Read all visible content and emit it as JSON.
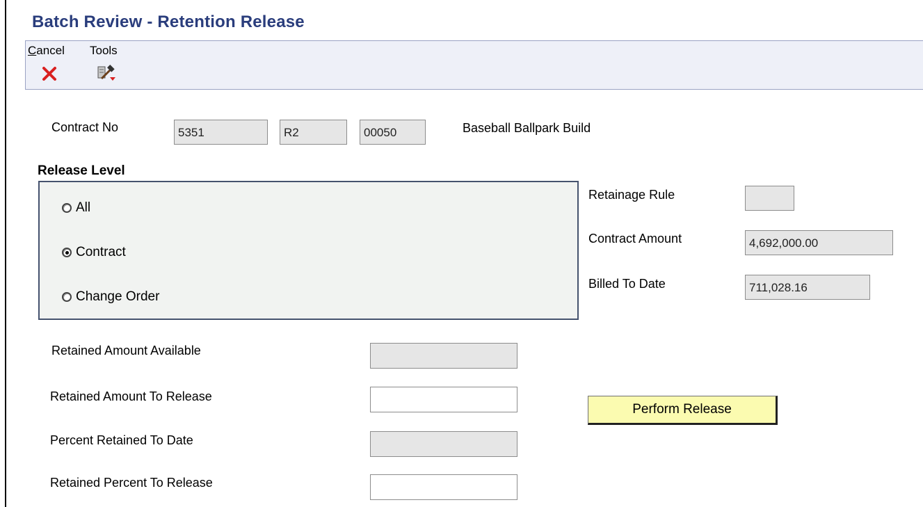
{
  "title": "Batch Review - Retention Release",
  "toolbar": {
    "cancel_label_first": "C",
    "cancel_label_rest": "ancel",
    "cancel_icon": "red-x-icon",
    "tools_label": "Tools",
    "tools_icon": "tools-hammer-icon"
  },
  "contract": {
    "label": "Contract No",
    "number": "5351",
    "type": "R2",
    "company": "00050",
    "description": "Baseball Ballpark Build"
  },
  "release_level": {
    "title": "Release Level",
    "options": [
      {
        "label": "All",
        "checked": false
      },
      {
        "label": "Contract",
        "checked": true
      },
      {
        "label": "Change Order",
        "checked": false
      }
    ]
  },
  "right_fields": {
    "retainage_rule_label": "Retainage Rule",
    "retainage_rule_value": "",
    "contract_amount_label": "Contract Amount",
    "contract_amount_value": "4,692,000.00",
    "billed_to_date_label": "Billed To Date",
    "billed_to_date_value": "711,028.16"
  },
  "retention": {
    "available_label": "Retained Amount Available",
    "available_value": "",
    "to_release_label": "Retained Amount To Release",
    "to_release_value": "",
    "percent_to_date_label": "Percent Retained To Date",
    "percent_to_date_value": "",
    "percent_to_release_label": "Retained Percent To Release",
    "percent_to_release_value": ""
  },
  "perform_release_label": "Perform Release",
  "colors": {
    "title": "#2a3d7c",
    "toolbar_bg": "#eef0f8",
    "button_bg": "#fbfbb0",
    "cancel_icon": "#d92020"
  }
}
